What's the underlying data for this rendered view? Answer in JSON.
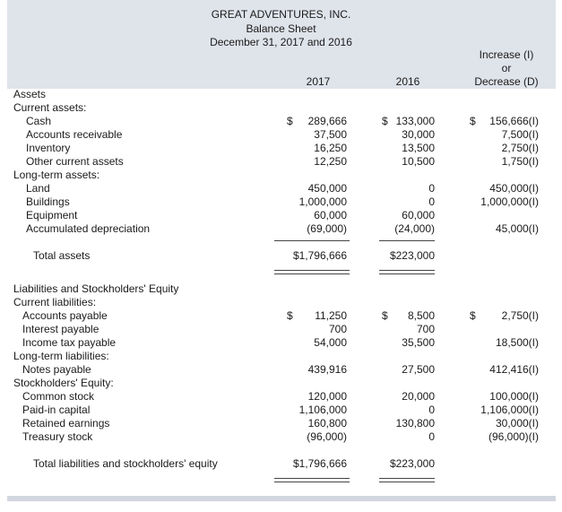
{
  "header": {
    "company": "GREAT ADVENTURES, INC.",
    "statement": "Balance Sheet",
    "dates": "December 31, 2017 and 2016"
  },
  "columns": {
    "y2017": "2017",
    "y2016": "2016",
    "change_line1": "Increase (I)",
    "change_line2": "or",
    "change_line3": "Decrease (D)"
  },
  "rows": [
    {
      "label": "Assets"
    },
    {
      "label": "Current assets:"
    },
    {
      "label": "Cash",
      "dollar_2017": "$",
      "v2017": "289,666",
      "dollar_2016": "$",
      "v2016": "133,000",
      "dollar_change": "$",
      "change": "156,666(I)"
    },
    {
      "label": "Accounts receivable",
      "v2017": "37,500",
      "v2016": "30,000",
      "change": "7,500(I)"
    },
    {
      "label": "Inventory",
      "v2017": "16,250",
      "v2016": "13,500",
      "change": "2,750(I)"
    },
    {
      "label": "Other current assets",
      "v2017": "12,250",
      "v2016": "10,500",
      "change": "1,750(I)"
    },
    {
      "label": "Long-term assets:"
    },
    {
      "label": "Land",
      "v2017": "450,000",
      "v2016": "0",
      "change": "450,000(I)"
    },
    {
      "label": "Buildings",
      "v2017": "1,000,000",
      "v2016": "0",
      "change": "1,000,000(I)"
    },
    {
      "label": "Equipment",
      "v2017": "60,000",
      "v2016": "60,000"
    },
    {
      "label": "Accumulated depreciation",
      "v2017": "(69,000)",
      "v2016": "(24,000)",
      "change": "45,000(I)"
    },
    {
      "label": "Total assets",
      "v2017": "$1,796,666",
      "v2016": "$223,000"
    },
    {
      "label": "Liabilities and Stockholders' Equity"
    },
    {
      "label": "Current liabilities:"
    },
    {
      "label": "Accounts payable",
      "dollar_2017": "$",
      "v2017": "11,250",
      "dollar_2016": "$",
      "v2016": "8,500",
      "dollar_change": "$",
      "change": "2,750(I)"
    },
    {
      "label": "Interest payable",
      "v2017": "700",
      "v2016": "700"
    },
    {
      "label": "Income tax payable",
      "v2017": "54,000",
      "v2016": "35,500",
      "change": "18,500(I)"
    },
    {
      "label": "Long-term liabilities:"
    },
    {
      "label": "Notes payable",
      "v2017": "439,916",
      "v2016": "27,500",
      "change": "412,416(I)"
    },
    {
      "label": "Stockholders' Equity:"
    },
    {
      "label": "Common stock",
      "v2017": "120,000",
      "v2016": "20,000",
      "change": "100,000(I)"
    },
    {
      "label": "Paid-in capital",
      "v2017": "1,106,000",
      "v2016": "0",
      "change": "1,106,000(I)"
    },
    {
      "label": "Retained earnings",
      "v2017": "160,800",
      "v2016": "130,800",
      "change": "30,000(I)"
    },
    {
      "label": "Treasury stock",
      "v2017": "(96,000)",
      "v2016": "0",
      "change": "(96,000)(I)"
    },
    {
      "label": "Total liabilities and stockholders' equity",
      "v2017": "$1,796,666",
      "v2016": "$223,000"
    }
  ]
}
